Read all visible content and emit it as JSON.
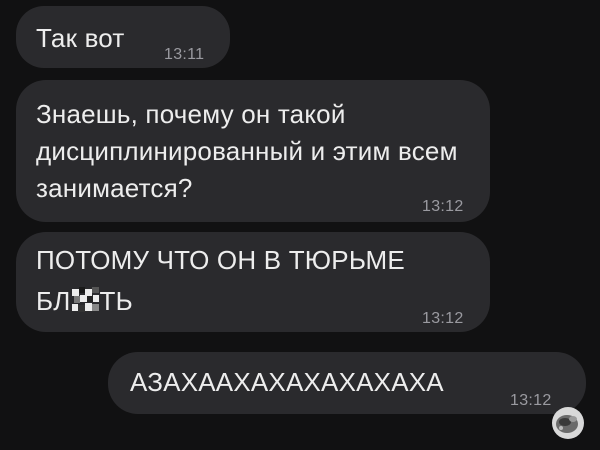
{
  "messages": [
    {
      "text": "Так вот",
      "time": "13:11",
      "direction": "incoming"
    },
    {
      "text": "Знаешь, почему он такой дисциплинированный и этим всем занимается?",
      "time": "13:12",
      "direction": "incoming"
    },
    {
      "line1": "ПОТОМУ ЧТО ОН В ТЮРЬМЕ",
      "line2_start": "БЛ",
      "line2_end": "ТЬ",
      "time": "13:12",
      "direction": "incoming"
    },
    {
      "text": "АЗАХААХАХАХАХАХАХА",
      "time": "13:12",
      "direction": "outgoing"
    }
  ],
  "colors": {
    "background": "#111112",
    "bubble": "#2a2a2d",
    "text": "#ededed",
    "timestamp": "#9a9aa0"
  },
  "icons": {
    "censor": "censored-pixel-icon",
    "reaction": "reaction-emoji-icon"
  }
}
